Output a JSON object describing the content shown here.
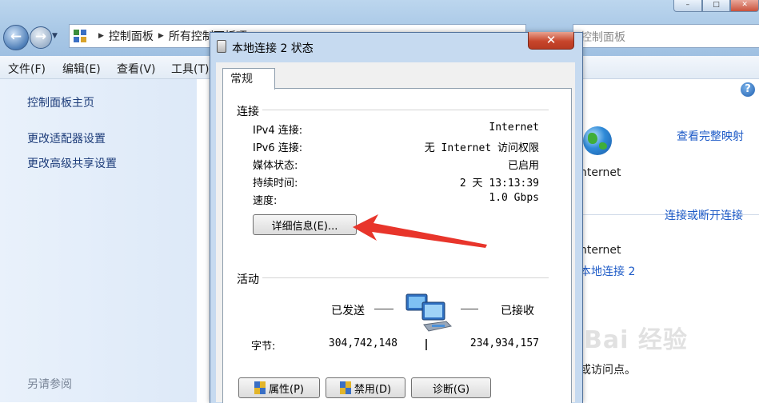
{
  "explorer": {
    "breadcrumb": [
      "控制面板",
      "所有控制面板项"
    ],
    "search_placeholder": "控制面板",
    "menu": [
      "文件(F)",
      "编辑(E)",
      "查看(V)",
      "工具(T)"
    ],
    "sidebar_links": [
      "控制面板主页",
      "更改适配器设置",
      "更改高级共享设置"
    ],
    "see_also": "另请参阅",
    "right": {
      "view_full_map": "查看完整映射",
      "internet_label": "nternet",
      "connect_disconnect": "连接或断开连接",
      "access_type": "nternet",
      "connection_link": "本地连接 2",
      "bottom_text": "或访问点。"
    }
  },
  "dialog": {
    "title": "本地连接 2 状态",
    "tab": "常规",
    "connection_group": "连接",
    "rows": [
      {
        "label": "IPv4 连接:",
        "value": "Internet"
      },
      {
        "label": "IPv6 连接:",
        "value": "无 Internet 访问权限"
      },
      {
        "label": "媒体状态:",
        "value": "已启用"
      },
      {
        "label": "持续时间:",
        "value": "2 天 13:13:39"
      },
      {
        "label": "速度:",
        "value": "1.0 Gbps"
      }
    ],
    "details_button": "详细信息(E)...",
    "activity_group": "活动",
    "sent_label": "已发送",
    "received_label": "已接收",
    "bytes_label": "字节:",
    "bytes_sent": "304,742,148",
    "bytes_received": "234,934,157",
    "buttons": {
      "properties": "属性(P)",
      "disable": "禁用(D)",
      "diagnose": "诊断(G)"
    }
  },
  "watermark": "Bai 经验",
  "colors": {
    "link": "#1e5bc7",
    "arrow": "#e8352b",
    "close": "#c7452b"
  }
}
